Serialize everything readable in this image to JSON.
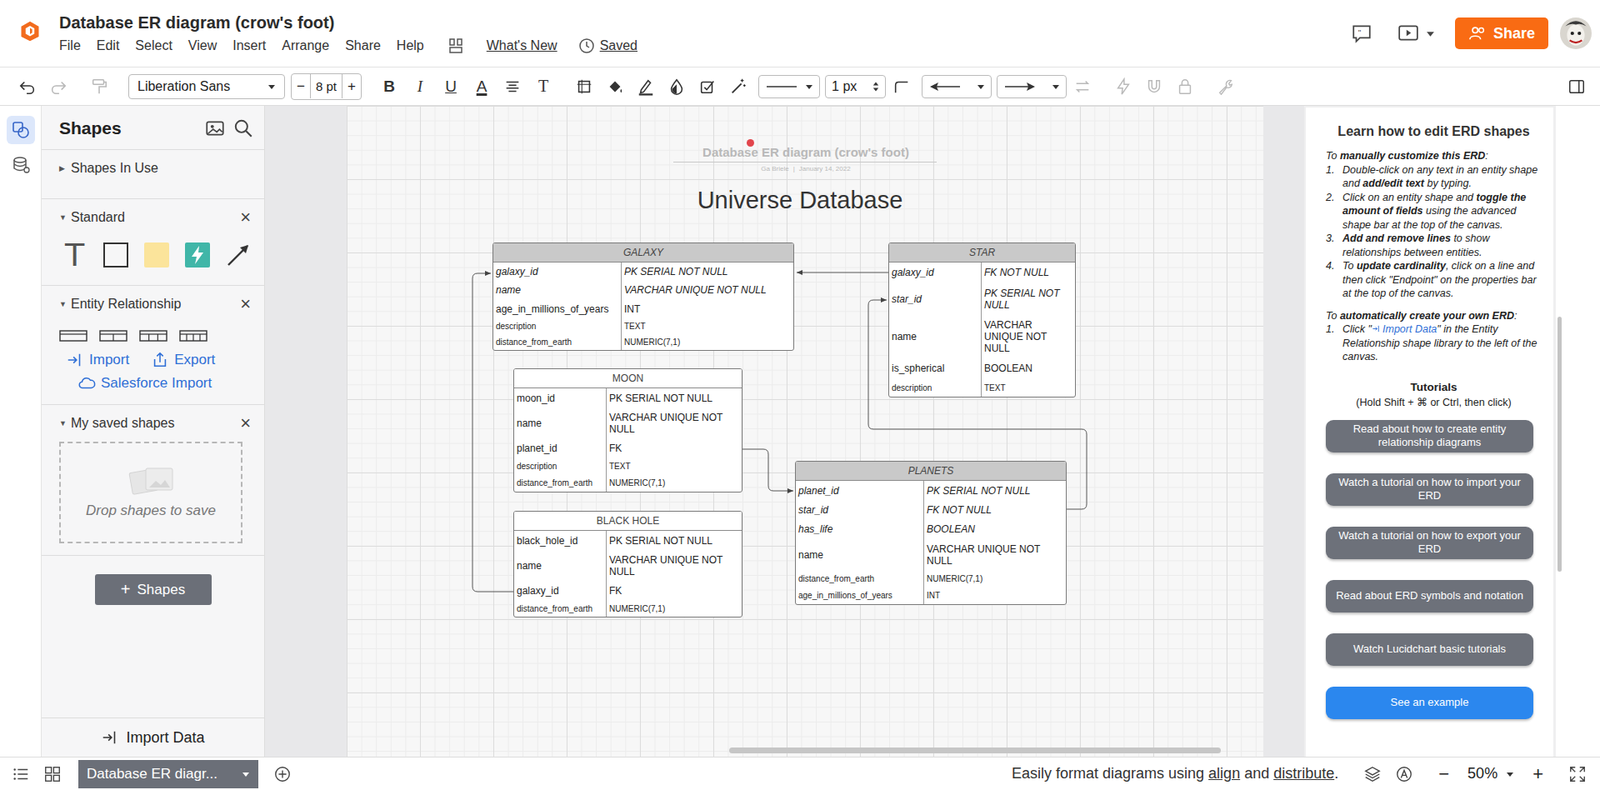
{
  "window": {
    "title": "Database ER diagram (crow's foot)"
  },
  "menu": [
    {
      "label": "File"
    },
    {
      "label": "Edit"
    },
    {
      "label": "Select"
    },
    {
      "label": "View"
    },
    {
      "label": "Insert"
    },
    {
      "label": "Arrange"
    },
    {
      "label": "Share"
    },
    {
      "label": "Help"
    }
  ],
  "whats_new": "What's New",
  "save_status": "Saved",
  "share_button": "Share",
  "toolbar": {
    "font": "Liberation Sans",
    "decrease": "−",
    "font_size": "8 pt",
    "increase": "+",
    "bold": "B",
    "italic": "I",
    "underline": "U",
    "text_color": "A",
    "text_options": "T",
    "line_width": "1 px",
    "undo_disabled": false,
    "redo_disabled": true,
    "painter_disabled": true,
    "swap_disabled": true,
    "actions_disabled": true,
    "magnet_disabled": true,
    "lock_disabled": true,
    "wrench_disabled": true
  },
  "left_rail": [
    {
      "kind": "shapes",
      "selected": true
    },
    {
      "kind": "data",
      "selected": false
    }
  ],
  "shapes_panel": {
    "title": "Shapes",
    "sections": [
      {
        "title": "Shapes In Use",
        "expanded": false,
        "closable": false
      },
      {
        "title": "Standard",
        "expanded": true,
        "closable": true
      },
      {
        "title": "Entity Relationship",
        "expanded": true,
        "closable": true
      },
      {
        "title": "My saved shapes",
        "expanded": true,
        "closable": true
      }
    ],
    "collapsed_glyph": "▶",
    "expanded_glyph": "▼",
    "close_glyph": "×",
    "standard_shapes": [
      {
        "kind": "text",
        "label": "T"
      },
      {
        "kind": "rect"
      },
      {
        "kind": "note"
      },
      {
        "kind": "action"
      },
      {
        "kind": "arrow"
      }
    ],
    "er_shapes": [
      {
        "columns": 1
      },
      {
        "columns": 2
      },
      {
        "columns": 3
      },
      {
        "columns": 4
      }
    ],
    "er_links": [
      {
        "label": "Import",
        "kind": "import"
      },
      {
        "label": "Export",
        "kind": "export"
      },
      {
        "label": "Salesforce Import",
        "kind": "cloud"
      }
    ],
    "drop_hint": "Drop shapes to save",
    "add_glyph": "+",
    "add_label": "Shapes",
    "import_data": "Import Data"
  },
  "canvas": {
    "doc_title": "Database ER diagram (crow's foot)",
    "doc_author": "Ga Briele",
    "meta_separator": "|",
    "doc_date": "January 14, 2022",
    "heading": "Universe Database",
    "entities": [
      {
        "name": "GALAXY",
        "shaded": true,
        "rows": [
          {
            "name": "galaxy_id",
            "type": "PK SERIAL NOT NULL",
            "italic": true,
            "small": false
          },
          {
            "name": "name",
            "type": "VARCHAR UNIQUE NOT NULL",
            "italic": true,
            "small": false
          },
          {
            "name": "age_in_millions_of_years",
            "type": "INT",
            "italic": false,
            "small": false
          },
          {
            "name": "description",
            "type": "TEXT",
            "italic": false,
            "small": true
          },
          {
            "name": "distance_from_earth",
            "type": "NUMERIC(7,1)",
            "italic": false,
            "small": true
          }
        ]
      },
      {
        "name": "STAR",
        "shaded": true,
        "rows": [
          {
            "name": "galaxy_id",
            "type": "FK NOT NULL",
            "italic": true,
            "small": false
          },
          {
            "name": "star_id",
            "type": "PK SERIAL NOT NULL",
            "italic": true,
            "small": false
          },
          {
            "name": "name",
            "type": "VARCHAR UNIQUE NOT NULL",
            "italic": false,
            "small": false
          },
          {
            "name": "is_spherical",
            "type": "BOOLEAN",
            "italic": false,
            "small": false
          },
          {
            "name": "description",
            "type": "TEXT",
            "italic": false,
            "small": true
          }
        ]
      },
      {
        "name": "MOON",
        "shaded": false,
        "rows": [
          {
            "name": "moon_id",
            "type": "PK SERIAL NOT NULL",
            "italic": false,
            "small": false
          },
          {
            "name": "name",
            "type": "VARCHAR UNIQUE NOT NULL",
            "italic": false,
            "small": false
          },
          {
            "name": "planet_id",
            "type": "FK",
            "italic": false,
            "small": false
          },
          {
            "name": "description",
            "type": "TEXT",
            "italic": false,
            "small": true
          },
          {
            "name": "distance_from_earth",
            "type": "NUMERIC(7,1)",
            "italic": false,
            "small": true
          }
        ]
      },
      {
        "name": "BLACK HOLE",
        "shaded": false,
        "rows": [
          {
            "name": "black_hole_id",
            "type": "PK SERIAL NOT NULL",
            "italic": false,
            "small": false
          },
          {
            "name": "name",
            "type": "VARCHAR UNIQUE NOT NULL",
            "italic": false,
            "small": false
          },
          {
            "name": "galaxy_id",
            "type": "FK",
            "italic": false,
            "small": false
          },
          {
            "name": "distance_from_earth",
            "type": "NUMERIC(7,1)",
            "italic": false,
            "small": true
          }
        ]
      },
      {
        "name": "PLANETS",
        "shaded": true,
        "rows": [
          {
            "name": "planet_id",
            "type": "PK SERIAL NOT NULL",
            "italic": true,
            "small": false
          },
          {
            "name": "star_id",
            "type": "FK NOT NULL",
            "italic": true,
            "small": false
          },
          {
            "name": "has_life",
            "type": "BOOLEAN",
            "italic": true,
            "small": false
          },
          {
            "name": "name",
            "type": "VARCHAR UNIQUE NOT NULL",
            "italic": false,
            "small": false
          },
          {
            "name": "distance_from_earth",
            "type": "NUMERIC(7,1)",
            "italic": false,
            "small": true
          },
          {
            "name": "age_in_millions_of_years",
            "type": "INT",
            "italic": false,
            "small": true
          }
        ]
      }
    ],
    "relationships": [
      {
        "from": "STAR",
        "to": "GALAXY"
      },
      {
        "from": "BLACK HOLE",
        "to": "GALAXY"
      },
      {
        "from": "MOON",
        "to": "PLANETS"
      },
      {
        "from": "PLANETS",
        "to": "STAR"
      }
    ]
  },
  "help_panel": {
    "title": "Learn how to edit ERD shapes",
    "manual_intro": [
      {
        "text": "To ",
        "style": "plain"
      },
      {
        "text": "manually customize this ERD",
        "style": "bold"
      },
      {
        "text": ":",
        "style": "plain"
      }
    ],
    "manual_steps": [
      {
        "number": "1.",
        "parts": [
          {
            "text": "Double-click on any text in an entity shape and ",
            "style": "plain"
          },
          {
            "text": "add/edit text",
            "style": "bold"
          },
          {
            "text": " by typing.",
            "style": "plain"
          }
        ]
      },
      {
        "number": "2.",
        "parts": [
          {
            "text": "Click on an entity shape and ",
            "style": "plain"
          },
          {
            "text": "toggle the amount of fields",
            "style": "bold"
          },
          {
            "text": " using the advanced shape bar at the top of the canvas.",
            "style": "plain"
          }
        ]
      },
      {
        "number": "3.",
        "parts": [
          {
            "text": "Add and remove lines",
            "style": "bold"
          },
          {
            "text": " to show relationships between entities.",
            "style": "plain"
          }
        ]
      },
      {
        "number": "4.",
        "parts": [
          {
            "text": "To ",
            "style": "plain"
          },
          {
            "text": "update cardinality",
            "style": "bold"
          },
          {
            "text": ", click on a line and then click \"Endpoint\" on the properties bar at the top of the canvas.",
            "style": "plain"
          }
        ]
      }
    ],
    "auto_intro": [
      {
        "text": "To ",
        "style": "plain"
      },
      {
        "text": "automatically create your own ERD",
        "style": "bold"
      },
      {
        "text": ":",
        "style": "plain"
      }
    ],
    "auto_steps": [
      {
        "number": "1.",
        "parts": [
          {
            "text": "Click \"",
            "style": "plain"
          },
          {
            "text": "Import Data",
            "style": "link"
          },
          {
            "text": "\" in the Entity Relationship shape library to the left of the canvas.",
            "style": "plain"
          }
        ]
      }
    ],
    "tutorials_title": "Tutorials",
    "tutorials_hint": "(Hold Shift + ⌘ or Ctrl, then click)",
    "buttons": [
      {
        "label": "Read about how to create entity relationship diagrams",
        "primary": false
      },
      {
        "label": "Watch a tutorial on how to import your ERD",
        "primary": false
      },
      {
        "label": "Watch a tutorial on how to export your ERD",
        "primary": false
      },
      {
        "label": "Read about ERD symbols and notation",
        "primary": false
      },
      {
        "label": "Watch Lucidchart basic tutorials",
        "primary": false
      },
      {
        "label": "See an example",
        "primary": true
      }
    ]
  },
  "bottom_bar": {
    "page_tab": "Database ER diagr...",
    "hint_parts": [
      {
        "text": "Easily format diagrams using ",
        "style": "plain"
      },
      {
        "text": "align",
        "style": "link"
      },
      {
        "text": " and ",
        "style": "plain"
      },
      {
        "text": "distribute",
        "style": "link"
      },
      {
        "text": ".",
        "style": "plain"
      }
    ],
    "zoom_out": "−",
    "zoom": "50%",
    "zoom_in": "+"
  }
}
